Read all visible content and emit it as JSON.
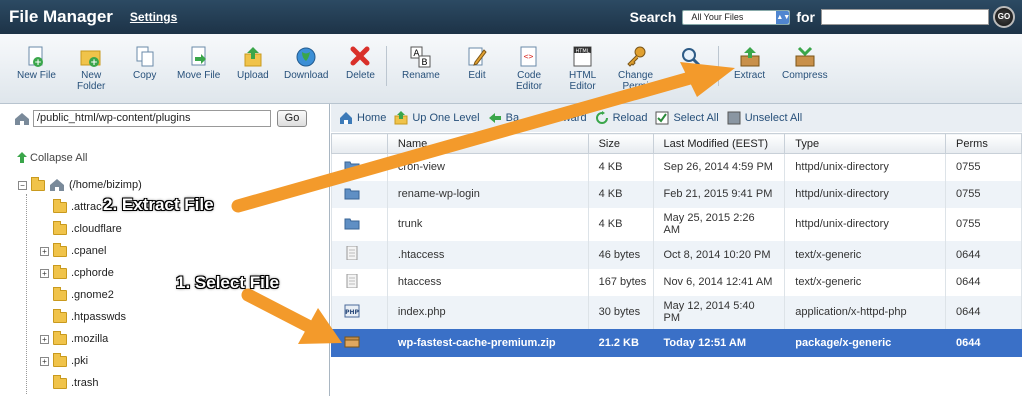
{
  "header": {
    "title": "File Manager",
    "settings": "Settings",
    "search_label": "Search",
    "search_scope": "All Your Files",
    "for_label": "for",
    "search_value": "",
    "go": "GO"
  },
  "toolbar": {
    "items": [
      {
        "label": "New File",
        "icon": "new-file-icon"
      },
      {
        "label": "New\nFolder",
        "icon": "new-folder-icon"
      },
      {
        "label": "Copy",
        "icon": "copy-icon"
      },
      {
        "label": "Move File",
        "icon": "move-file-icon"
      },
      {
        "label": "Upload",
        "icon": "upload-icon"
      },
      {
        "label": "Download",
        "icon": "download-icon"
      },
      {
        "label": "Delete",
        "icon": "delete-icon"
      },
      {
        "label": "Rename",
        "icon": "rename-icon"
      },
      {
        "label": "Edit",
        "icon": "edit-icon"
      },
      {
        "label": "Code\nEditor",
        "icon": "code-editor-icon"
      },
      {
        "label": "HTML\nEditor",
        "icon": "html-editor-icon"
      },
      {
        "label": "Change\nPermi",
        "icon": "change-permissions-icon"
      },
      {
        "label": "",
        "icon": "view-icon"
      },
      {
        "label": "Extract",
        "icon": "extract-icon"
      },
      {
        "label": "Compress",
        "icon": "compress-icon"
      }
    ]
  },
  "left": {
    "path": "/public_html/wp-content/plugins",
    "go": "Go",
    "collapse_all": "Collapse All",
    "root": "(/home/bizimp)",
    "folders": [
      ".attrac",
      ".cloudflare",
      ".cpanel",
      ".cphorde",
      ".gnome2",
      ".htpasswds",
      ".mozilla",
      ".pki",
      ".trash"
    ]
  },
  "nav": {
    "home": "Home",
    "up_one_level": "Up One Level",
    "back": "Ba",
    "forward": "rward",
    "reload": "Reload",
    "select_all": "Select All",
    "unselect_all": "Unselect All"
  },
  "table": {
    "headers": [
      "Name",
      "Size",
      "Last Modified (EEST)",
      "Type",
      "Perms"
    ],
    "rows": [
      {
        "name": "cron-view",
        "size": "4 KB",
        "modified": "Sep 26, 2014 4:59 PM",
        "type": "httpd/unix-directory",
        "perms": "0755",
        "icon": "folder-icon"
      },
      {
        "name": "rename-wp-login",
        "size": "4 KB",
        "modified": "Feb 21, 2015 9:41 PM",
        "type": "httpd/unix-directory",
        "perms": "0755",
        "icon": "folder-icon"
      },
      {
        "name": "trunk",
        "size": "4 KB",
        "modified": "May 25, 2015 2:26\nAM",
        "type": "httpd/unix-directory",
        "perms": "0755",
        "icon": "folder-icon"
      },
      {
        "name": ".htaccess",
        "size": "46 bytes",
        "modified": "Oct 8, 2014 10:20 PM",
        "type": "text/x-generic",
        "perms": "0644",
        "icon": "text-file-icon"
      },
      {
        "name": "htaccess",
        "size": "167 bytes",
        "modified": "Nov 6, 2014 12:41 AM",
        "type": "text/x-generic",
        "perms": "0644",
        "icon": "text-file-icon"
      },
      {
        "name": "index.php",
        "size": "30 bytes",
        "modified": "May 12, 2014 5:40\nPM",
        "type": "application/x-httpd-php",
        "perms": "0644",
        "icon": "php-file-icon"
      },
      {
        "name": "wp-fastest-cache-premium.zip",
        "size": "21.2 KB",
        "modified": "Today 12:51 AM",
        "type": "package/x-generic",
        "perms": "0644",
        "icon": "package-icon",
        "selected": true
      }
    ]
  },
  "annotations": {
    "step1": "1. Select File",
    "step2": "2. Extract File",
    "arrow_color": "#f39a2b"
  }
}
